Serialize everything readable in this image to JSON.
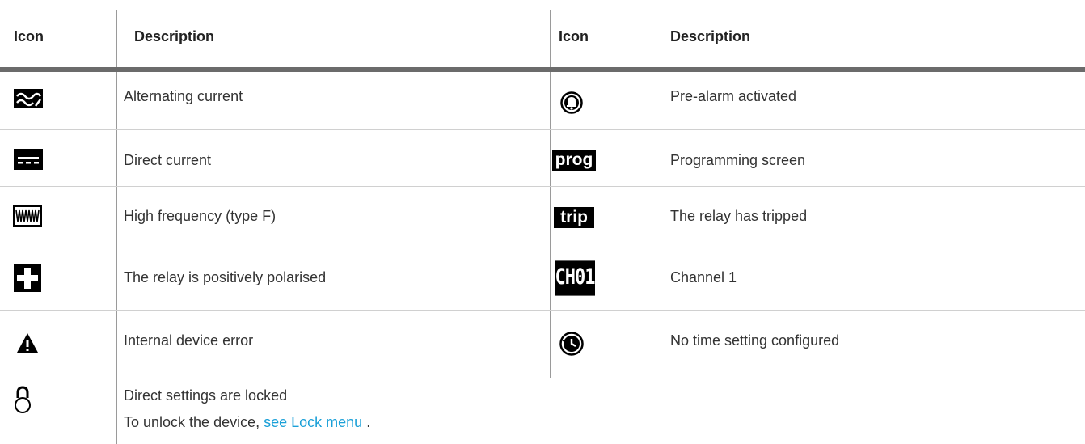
{
  "headers": {
    "icon_left": "Icon",
    "desc_left": "Description",
    "icon_right": "Icon",
    "desc_right": "Description"
  },
  "rows_left": [
    {
      "icon": "alternating-current-icon",
      "description": "Alternating current"
    },
    {
      "icon": "direct-current-icon",
      "description": "Direct current"
    },
    {
      "icon": "high-frequency-icon",
      "description": "High frequency (type F)"
    },
    {
      "icon": "positive-polarised-icon",
      "description": "The relay is positively polarised"
    },
    {
      "icon": "warning-triangle-icon",
      "description": "Internal device error"
    }
  ],
  "rows_right": [
    {
      "icon": "pre-alarm-bell-icon",
      "description": "Pre-alarm activated"
    },
    {
      "icon": "prog-icon",
      "label": "prog",
      "description": "Programming screen"
    },
    {
      "icon": "trip-icon",
      "label": "trip",
      "description": "The relay has tripped"
    },
    {
      "icon": "channel-icon",
      "label": "CH01",
      "description": "Channel 1"
    },
    {
      "icon": "clock-history-icon",
      "description": "No time setting configured"
    }
  ],
  "last_row": {
    "icon": "lock-icon",
    "line1": "Direct settings are locked",
    "line2_prefix": "To unlock the device,",
    "link_text": "see Lock menu",
    "line2_suffix": "."
  },
  "colors": {
    "link": "#1aa0d8",
    "header_rule": "#6b6b6b",
    "row_rule": "#d0d0d0",
    "icon": "#000000"
  }
}
